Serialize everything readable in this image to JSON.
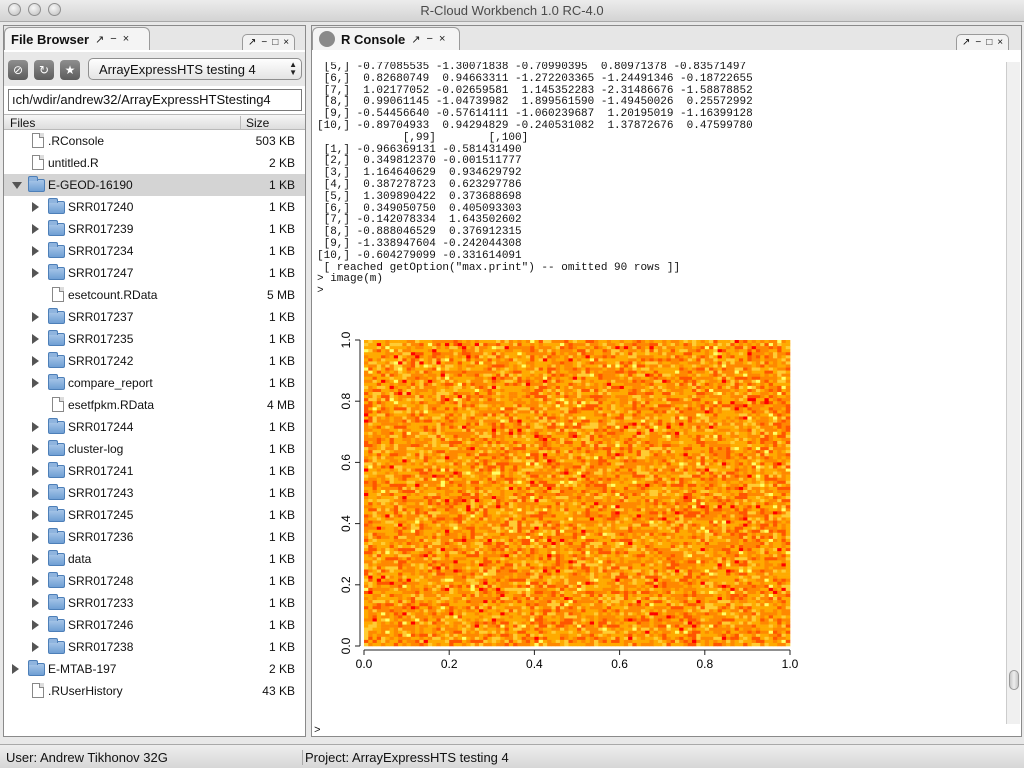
{
  "window": {
    "title": "R-Cloud Workbench 1.0 RC-4.0"
  },
  "file_browser": {
    "tab_label": "File Browser",
    "tab_controls": [
      "↗",
      "−",
      "×"
    ],
    "mini_controls": [
      "↗",
      "−",
      "□",
      "×"
    ],
    "toolbar_icons": [
      "disconnect-icon",
      "refresh-icon",
      "star-icon"
    ],
    "project_select": "ArrayExpressHTS testing 4",
    "path": "ıch/wdir/andrew32/ArrayExpressHTStesting4",
    "columns": {
      "name": "Files",
      "size": "Size"
    },
    "rows": [
      {
        "name": ".RConsole",
        "size": "503 KB",
        "type": "file",
        "depth": 0,
        "expander": "none"
      },
      {
        "name": "untitled.R",
        "size": "2 KB",
        "type": "file",
        "depth": 0,
        "expander": "none"
      },
      {
        "name": "E-GEOD-16190",
        "size": "1 KB",
        "type": "folder",
        "depth": 0,
        "expander": "down",
        "selected": true
      },
      {
        "name": "SRR017240",
        "size": "1 KB",
        "type": "folder",
        "depth": 1,
        "expander": "right"
      },
      {
        "name": "SRR017239",
        "size": "1 KB",
        "type": "folder",
        "depth": 1,
        "expander": "right"
      },
      {
        "name": "SRR017234",
        "size": "1 KB",
        "type": "folder",
        "depth": 1,
        "expander": "right"
      },
      {
        "name": "SRR017247",
        "size": "1 KB",
        "type": "folder",
        "depth": 1,
        "expander": "right"
      },
      {
        "name": "esetcount.RData",
        "size": "5 MB",
        "type": "file",
        "depth": 1,
        "expander": "none"
      },
      {
        "name": "SRR017237",
        "size": "1 KB",
        "type": "folder",
        "depth": 1,
        "expander": "right"
      },
      {
        "name": "SRR017235",
        "size": "1 KB",
        "type": "folder",
        "depth": 1,
        "expander": "right"
      },
      {
        "name": "SRR017242",
        "size": "1 KB",
        "type": "folder",
        "depth": 1,
        "expander": "right"
      },
      {
        "name": "compare_report",
        "size": "1 KB",
        "type": "folder",
        "depth": 1,
        "expander": "right"
      },
      {
        "name": "esetfpkm.RData",
        "size": "4 MB",
        "type": "file",
        "depth": 1,
        "expander": "none"
      },
      {
        "name": "SRR017244",
        "size": "1 KB",
        "type": "folder",
        "depth": 1,
        "expander": "right"
      },
      {
        "name": "cluster-log",
        "size": "1 KB",
        "type": "folder",
        "depth": 1,
        "expander": "right"
      },
      {
        "name": "SRR017241",
        "size": "1 KB",
        "type": "folder",
        "depth": 1,
        "expander": "right"
      },
      {
        "name": "SRR017243",
        "size": "1 KB",
        "type": "folder",
        "depth": 1,
        "expander": "right"
      },
      {
        "name": "SRR017245",
        "size": "1 KB",
        "type": "folder",
        "depth": 1,
        "expander": "right"
      },
      {
        "name": "SRR017236",
        "size": "1 KB",
        "type": "folder",
        "depth": 1,
        "expander": "right"
      },
      {
        "name": "data",
        "size": "1 KB",
        "type": "folder",
        "depth": 1,
        "expander": "right"
      },
      {
        "name": "SRR017248",
        "size": "1 KB",
        "type": "folder",
        "depth": 1,
        "expander": "right"
      },
      {
        "name": "SRR017233",
        "size": "1 KB",
        "type": "folder",
        "depth": 1,
        "expander": "right"
      },
      {
        "name": "SRR017246",
        "size": "1 KB",
        "type": "folder",
        "depth": 1,
        "expander": "right"
      },
      {
        "name": "SRR017238",
        "size": "1 KB",
        "type": "folder",
        "depth": 1,
        "expander": "right"
      },
      {
        "name": "E-MTAB-197",
        "size": "2 KB",
        "type": "folder",
        "depth": 0,
        "expander": "right"
      },
      {
        "name": ".RUserHistory",
        "size": "43 KB",
        "type": "file",
        "depth": 0,
        "expander": "none"
      }
    ]
  },
  "console": {
    "tab_label": "R Console",
    "tab_controls": [
      "↗",
      "−",
      "×"
    ],
    "mini_controls": [
      "↗",
      "−",
      "□",
      "×"
    ],
    "lines": [
      " [5,] -0.77085535 -1.30071838 -0.70990395  0.80971378 -0.83571497",
      " [6,]  0.82680749  0.94663311 -1.272203365 -1.24491346 -0.18722655",
      " [7,]  1.02177052 -0.02659581  1.145352283 -2.31486676 -1.58878852",
      " [8,]  0.99061145 -1.04739982  1.899561590 -1.49450026  0.25572992",
      " [9,] -0.54456640 -0.57614111 -1.060239687  1.20195019 -1.16399128",
      "[10,] -0.89704933  0.94294829 -0.240531082  1.37872676  0.47599780",
      "             [,99]        [,100]",
      " [1,] -0.966369131 -0.581431490",
      " [2,]  0.349812370 -0.001511777",
      " [3,]  1.164640629  0.934629792",
      " [4,]  0.387278723  0.623297786",
      " [5,]  1.309890422  0.373688698",
      " [6,]  0.349050750  0.405093303",
      " [7,] -0.142078334  1.643502602",
      " [8,] -0.888046529  0.376912315",
      " [9,] -1.338947604 -0.242044308",
      "[10,] -0.604279099 -0.331614091",
      " [ reached getOption(\"max.print\") -- omitted 90 rows ]]",
      "> image(m)",
      ">"
    ],
    "input_prompt": ">"
  },
  "chart_data": {
    "type": "heatmap",
    "x_ticks": [
      "0.0",
      "0.2",
      "0.4",
      "0.6",
      "0.8",
      "1.0"
    ],
    "y_ticks": [
      "0.0",
      "0.2",
      "0.4",
      "0.6",
      "0.8",
      "1.0"
    ],
    "xlim": [
      0,
      1
    ],
    "ylim": [
      0,
      1
    ],
    "grid": false,
    "colors": [
      "#ff0000",
      "#ff5500",
      "#ff8800",
      "#ffaa00",
      "#ffcc33",
      "#ffff66"
    ]
  },
  "statusbar": {
    "user": "User: Andrew Tikhonov 32G",
    "project": "Project: ArrayExpressHTS testing 4"
  }
}
